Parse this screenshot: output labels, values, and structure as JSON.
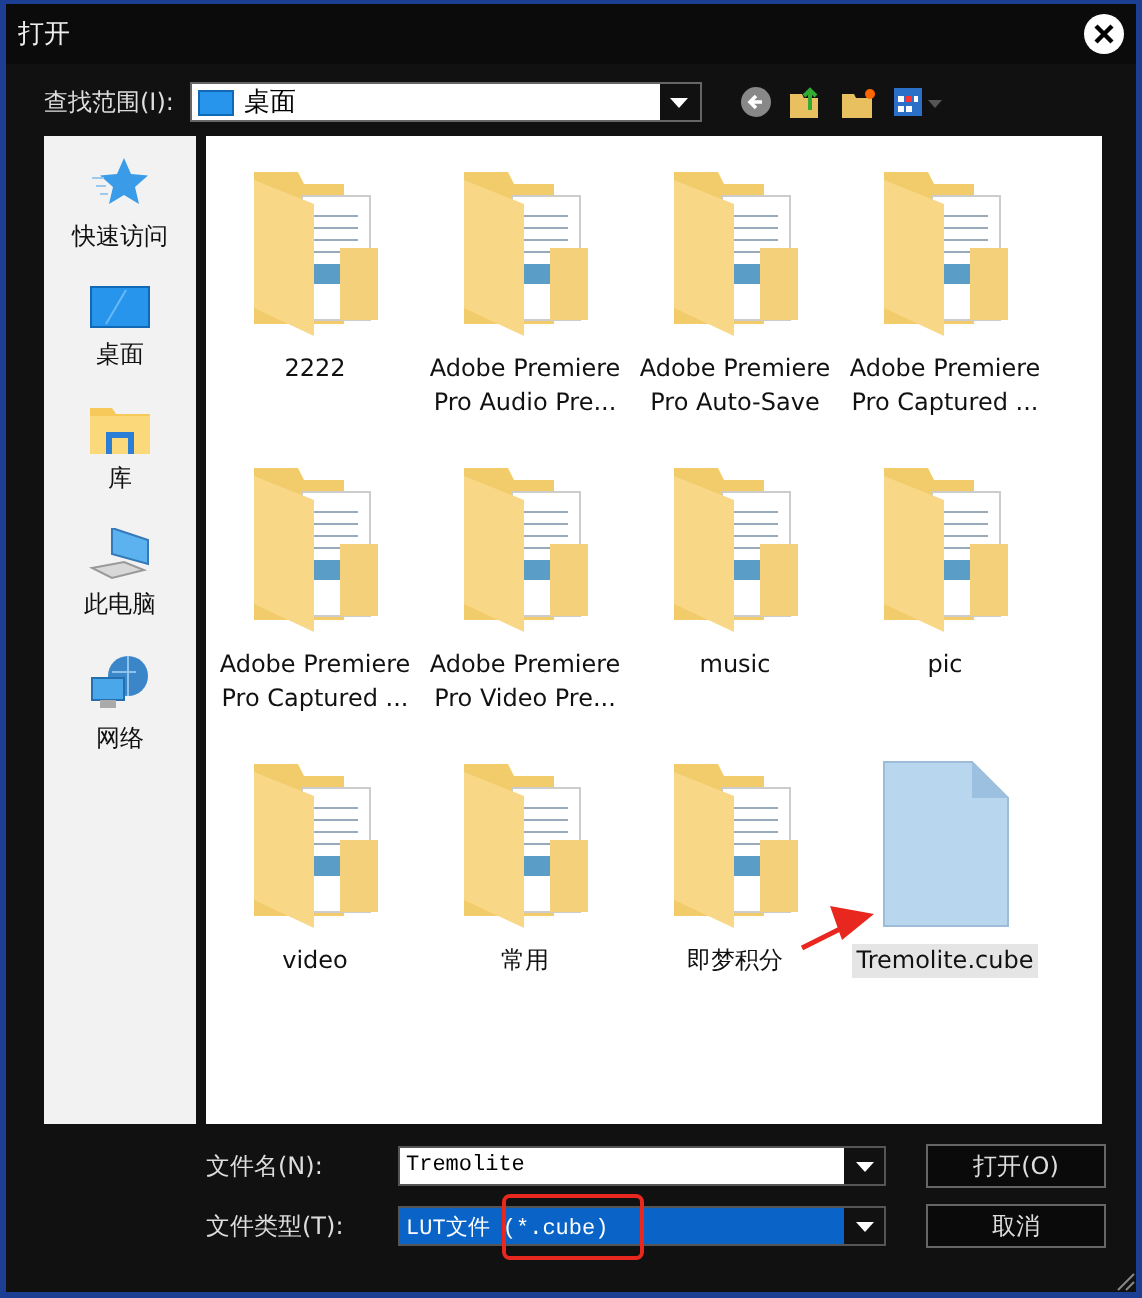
{
  "window": {
    "title": "打开"
  },
  "toolbar": {
    "label": "查找范围(I):",
    "location": "桌面"
  },
  "sidebar": {
    "items": [
      {
        "label": "快速访问",
        "kind": "star",
        "selected": false
      },
      {
        "label": "桌面",
        "kind": "desktop",
        "selected": false
      },
      {
        "label": "库",
        "kind": "library",
        "selected": false
      },
      {
        "label": "此电脑",
        "kind": "computer",
        "selected": false
      },
      {
        "label": "网络",
        "kind": "network",
        "selected": false
      }
    ]
  },
  "files": [
    {
      "name": "2222",
      "kind": "folder",
      "selected": false
    },
    {
      "name": "Adobe Premiere Pro Audio Pre...",
      "kind": "folder",
      "selected": false
    },
    {
      "name": "Adobe Premiere Pro Auto-Save",
      "kind": "folder",
      "selected": false
    },
    {
      "name": "Adobe Premiere Pro Captured ...",
      "kind": "folder",
      "selected": false
    },
    {
      "name": "Adobe Premiere Pro Captured ...",
      "kind": "folder",
      "selected": false
    },
    {
      "name": "Adobe Premiere Pro Video Pre...",
      "kind": "folder",
      "selected": false
    },
    {
      "name": "music",
      "kind": "folder",
      "selected": false
    },
    {
      "name": "pic",
      "kind": "folder",
      "selected": false
    },
    {
      "name": "video",
      "kind": "folder",
      "selected": false
    },
    {
      "name": "常用",
      "kind": "folder",
      "selected": false
    },
    {
      "name": "即梦积分",
      "kind": "folder",
      "selected": false
    },
    {
      "name": "Tremolite.cube",
      "kind": "file",
      "selected": true
    }
  ],
  "file_name": {
    "label": "文件名(N):",
    "value": "Tremolite"
  },
  "file_type": {
    "label": "文件类型(T):",
    "value": "LUT文件 (*.cube)",
    "selected": true
  },
  "buttons": [
    "打开(O)",
    "取消"
  ],
  "annotations": {
    "arrow": true,
    "highlight_frame": true
  }
}
